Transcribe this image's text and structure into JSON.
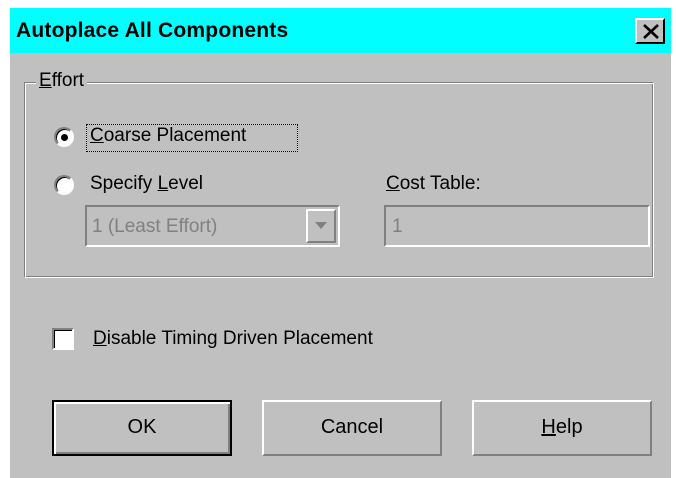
{
  "window": {
    "title": "Autoplace All Components",
    "close_icon": "close-icon",
    "title_bar_color": "#00ffff"
  },
  "effort_group": {
    "legend_prefix": "E",
    "legend_rest": "ffort",
    "options": [
      {
        "label_prefix": "",
        "label_mnemonic": "C",
        "label_rest": "oarse Placement",
        "selected": true
      },
      {
        "label_prefix": "Specify ",
        "label_mnemonic": "L",
        "label_rest": "evel",
        "selected": false
      }
    ],
    "level_select": {
      "value": "1 (Least Effort)",
      "enabled": false
    },
    "cost_table": {
      "label_mnemonic": "C",
      "label_rest": "ost Table:",
      "value": "1",
      "enabled": false
    }
  },
  "timing_checkbox": {
    "label_mnemonic": "D",
    "label_rest": "isable Timing Driven Placement",
    "checked": false
  },
  "buttons": {
    "ok": "OK",
    "cancel": "Cancel",
    "help_mnemonic": "H",
    "help_rest": "elp"
  }
}
